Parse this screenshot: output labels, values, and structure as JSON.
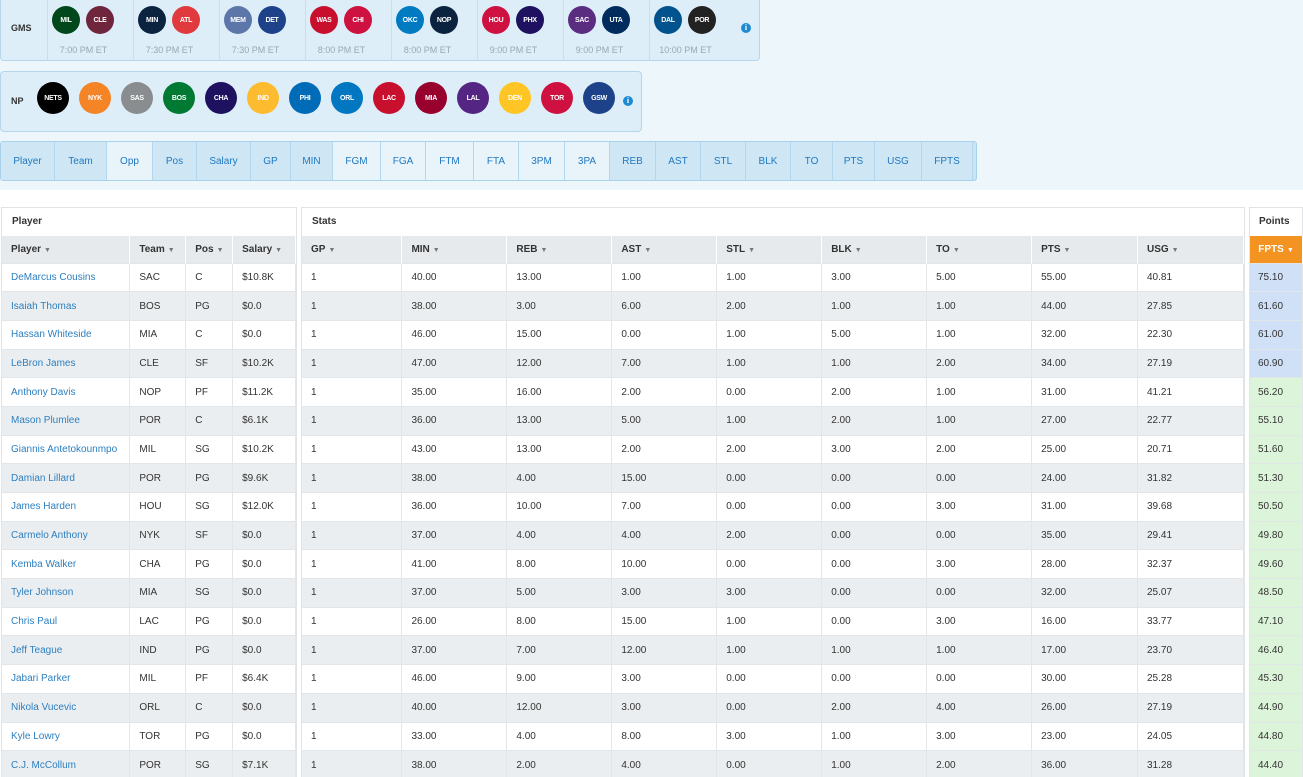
{
  "games": {
    "label": "GMS",
    "list": [
      {
        "away": "MIL",
        "home": "CLE",
        "time": "7:00 PM ET",
        "away_color": "#00471b",
        "home_color": "#6f263d"
      },
      {
        "away": "MIN",
        "home": "ATL",
        "time": "7:30 PM ET",
        "away_color": "#0c2340",
        "home_color": "#e03a3e"
      },
      {
        "away": "MEM",
        "home": "DET",
        "time": "7:30 PM ET",
        "away_color": "#5d76a9",
        "home_color": "#1d428a"
      },
      {
        "away": "WAS",
        "home": "CHI",
        "time": "8:00 PM ET",
        "away_color": "#c8102e",
        "home_color": "#ce1141"
      },
      {
        "away": "OKC",
        "home": "NOP",
        "time": "8:00 PM ET",
        "away_color": "#007ac1",
        "home_color": "#0c2340"
      },
      {
        "away": "HOU",
        "home": "PHX",
        "time": "9:00 PM ET",
        "away_color": "#ce1141",
        "home_color": "#1d1160"
      },
      {
        "away": "SAC",
        "home": "UTA",
        "time": "9:00 PM ET",
        "away_color": "#5a2d81",
        "home_color": "#002b5c"
      },
      {
        "away": "DAL",
        "home": "POR",
        "time": "10:00 PM ET",
        "away_color": "#00538c",
        "home_color": "#222222"
      }
    ]
  },
  "np": {
    "label": "NP",
    "teams": [
      {
        "abbr": "NETS",
        "color": "#000000"
      },
      {
        "abbr": "NYK",
        "color": "#f58426"
      },
      {
        "abbr": "SAS",
        "color": "#8a8d8f"
      },
      {
        "abbr": "BOS",
        "color": "#007a33"
      },
      {
        "abbr": "CHA",
        "color": "#1d1160"
      },
      {
        "abbr": "IND",
        "color": "#fdbb30"
      },
      {
        "abbr": "PHI",
        "color": "#006bb6"
      },
      {
        "abbr": "ORL",
        "color": "#0077c0"
      },
      {
        "abbr": "LAC",
        "color": "#c8102e"
      },
      {
        "abbr": "MIA",
        "color": "#98002e"
      },
      {
        "abbr": "LAL",
        "color": "#552583"
      },
      {
        "abbr": "DEN",
        "color": "#fec524"
      },
      {
        "abbr": "TOR",
        "color": "#ce1141"
      },
      {
        "abbr": "GSW",
        "color": "#1d428a"
      }
    ]
  },
  "column_toggles": [
    {
      "label": "Player",
      "on": false,
      "w": 54
    },
    {
      "label": "Team",
      "on": false,
      "w": 52
    },
    {
      "label": "Opp",
      "on": true,
      "w": 46
    },
    {
      "label": "Pos",
      "on": false,
      "w": 44
    },
    {
      "label": "Salary",
      "on": false,
      "w": 54
    },
    {
      "label": "GP",
      "on": false,
      "w": 40
    },
    {
      "label": "MIN",
      "on": false,
      "w": 42
    },
    {
      "label": "FGM",
      "on": true,
      "w": 48
    },
    {
      "label": "FGA",
      "on": true,
      "w": 45
    },
    {
      "label": "FTM",
      "on": true,
      "w": 48
    },
    {
      "label": "FTA",
      "on": true,
      "w": 45
    },
    {
      "label": "3PM",
      "on": true,
      "w": 46
    },
    {
      "label": "3PA",
      "on": true,
      "w": 45
    },
    {
      "label": "REB",
      "on": false,
      "w": 46
    },
    {
      "label": "AST",
      "on": false,
      "w": 45
    },
    {
      "label": "STL",
      "on": false,
      "w": 45
    },
    {
      "label": "BLK",
      "on": false,
      "w": 45
    },
    {
      "label": "TO",
      "on": false,
      "w": 42
    },
    {
      "label": "PTS",
      "on": false,
      "w": 42
    },
    {
      "label": "USG",
      "on": false,
      "w": 47
    },
    {
      "label": "FPTS",
      "on": false,
      "w": 51
    }
  ],
  "player_panel": {
    "title": "Player",
    "headers": [
      "Player",
      "Team",
      "Pos",
      "Salary"
    ]
  },
  "stats_panel": {
    "title": "Stats",
    "headers": [
      "GP",
      "MIN",
      "REB",
      "AST",
      "STL",
      "BLK",
      "TO",
      "PTS",
      "USG"
    ]
  },
  "points_panel": {
    "title": "Points",
    "header": "FPTS"
  },
  "rows": [
    {
      "player": "DeMarcus Cousins",
      "team": "SAC",
      "pos": "C",
      "salary": "$10.8K",
      "gp": "1",
      "min": "40.00",
      "reb": "13.00",
      "ast": "1.00",
      "stl": "1.00",
      "blk": "3.00",
      "to": "5.00",
      "pts": "55.00",
      "usg": "40.81",
      "fpts": "75.10",
      "tier": "blue"
    },
    {
      "player": "Isaiah Thomas",
      "team": "BOS",
      "pos": "PG",
      "salary": "$0.0",
      "gp": "1",
      "min": "38.00",
      "reb": "3.00",
      "ast": "6.00",
      "stl": "2.00",
      "blk": "1.00",
      "to": "1.00",
      "pts": "44.00",
      "usg": "27.85",
      "fpts": "61.60",
      "tier": "blue"
    },
    {
      "player": "Hassan Whiteside",
      "team": "MIA",
      "pos": "C",
      "salary": "$0.0",
      "gp": "1",
      "min": "46.00",
      "reb": "15.00",
      "ast": "0.00",
      "stl": "1.00",
      "blk": "5.00",
      "to": "1.00",
      "pts": "32.00",
      "usg": "22.30",
      "fpts": "61.00",
      "tier": "blue"
    },
    {
      "player": "LeBron James",
      "team": "CLE",
      "pos": "SF",
      "salary": "$10.2K",
      "gp": "1",
      "min": "47.00",
      "reb": "12.00",
      "ast": "7.00",
      "stl": "1.00",
      "blk": "1.00",
      "to": "2.00",
      "pts": "34.00",
      "usg": "27.19",
      "fpts": "60.90",
      "tier": "blue"
    },
    {
      "player": "Anthony Davis",
      "team": "NOP",
      "pos": "PF",
      "salary": "$11.2K",
      "gp": "1",
      "min": "35.00",
      "reb": "16.00",
      "ast": "2.00",
      "stl": "0.00",
      "blk": "2.00",
      "to": "1.00",
      "pts": "31.00",
      "usg": "41.21",
      "fpts": "56.20",
      "tier": "green"
    },
    {
      "player": "Mason Plumlee",
      "team": "POR",
      "pos": "C",
      "salary": "$6.1K",
      "gp": "1",
      "min": "36.00",
      "reb": "13.00",
      "ast": "5.00",
      "stl": "1.00",
      "blk": "2.00",
      "to": "1.00",
      "pts": "27.00",
      "usg": "22.77",
      "fpts": "55.10",
      "tier": "green"
    },
    {
      "player": "Giannis Antetokounmpo",
      "team": "MIL",
      "pos": "SG",
      "salary": "$10.2K",
      "gp": "1",
      "min": "43.00",
      "reb": "13.00",
      "ast": "2.00",
      "stl": "2.00",
      "blk": "3.00",
      "to": "2.00",
      "pts": "25.00",
      "usg": "20.71",
      "fpts": "51.60",
      "tier": "green"
    },
    {
      "player": "Damian Lillard",
      "team": "POR",
      "pos": "PG",
      "salary": "$9.6K",
      "gp": "1",
      "min": "38.00",
      "reb": "4.00",
      "ast": "15.00",
      "stl": "0.00",
      "blk": "0.00",
      "to": "0.00",
      "pts": "24.00",
      "usg": "31.82",
      "fpts": "51.30",
      "tier": "green"
    },
    {
      "player": "James Harden",
      "team": "HOU",
      "pos": "SG",
      "salary": "$12.0K",
      "gp": "1",
      "min": "36.00",
      "reb": "10.00",
      "ast": "7.00",
      "stl": "0.00",
      "blk": "0.00",
      "to": "3.00",
      "pts": "31.00",
      "usg": "39.68",
      "fpts": "50.50",
      "tier": "green"
    },
    {
      "player": "Carmelo Anthony",
      "team": "NYK",
      "pos": "SF",
      "salary": "$0.0",
      "gp": "1",
      "min": "37.00",
      "reb": "4.00",
      "ast": "4.00",
      "stl": "2.00",
      "blk": "0.00",
      "to": "0.00",
      "pts": "35.00",
      "usg": "29.41",
      "fpts": "49.80",
      "tier": "green"
    },
    {
      "player": "Kemba Walker",
      "team": "CHA",
      "pos": "PG",
      "salary": "$0.0",
      "gp": "1",
      "min": "41.00",
      "reb": "8.00",
      "ast": "10.00",
      "stl": "0.00",
      "blk": "0.00",
      "to": "3.00",
      "pts": "28.00",
      "usg": "32.37",
      "fpts": "49.60",
      "tier": "green"
    },
    {
      "player": "Tyler Johnson",
      "team": "MIA",
      "pos": "SG",
      "salary": "$0.0",
      "gp": "1",
      "min": "37.00",
      "reb": "5.00",
      "ast": "3.00",
      "stl": "3.00",
      "blk": "0.00",
      "to": "0.00",
      "pts": "32.00",
      "usg": "25.07",
      "fpts": "48.50",
      "tier": "green"
    },
    {
      "player": "Chris Paul",
      "team": "LAC",
      "pos": "PG",
      "salary": "$0.0",
      "gp": "1",
      "min": "26.00",
      "reb": "8.00",
      "ast": "15.00",
      "stl": "1.00",
      "blk": "0.00",
      "to": "3.00",
      "pts": "16.00",
      "usg": "33.77",
      "fpts": "47.10",
      "tier": "green"
    },
    {
      "player": "Jeff Teague",
      "team": "IND",
      "pos": "PG",
      "salary": "$0.0",
      "gp": "1",
      "min": "37.00",
      "reb": "7.00",
      "ast": "12.00",
      "stl": "1.00",
      "blk": "1.00",
      "to": "1.00",
      "pts": "17.00",
      "usg": "23.70",
      "fpts": "46.40",
      "tier": "green"
    },
    {
      "player": "Jabari Parker",
      "team": "MIL",
      "pos": "PF",
      "salary": "$6.4K",
      "gp": "1",
      "min": "46.00",
      "reb": "9.00",
      "ast": "3.00",
      "stl": "0.00",
      "blk": "0.00",
      "to": "0.00",
      "pts": "30.00",
      "usg": "25.28",
      "fpts": "45.30",
      "tier": "green"
    },
    {
      "player": "Nikola Vucevic",
      "team": "ORL",
      "pos": "C",
      "salary": "$0.0",
      "gp": "1",
      "min": "40.00",
      "reb": "12.00",
      "ast": "3.00",
      "stl": "0.00",
      "blk": "2.00",
      "to": "4.00",
      "pts": "26.00",
      "usg": "27.19",
      "fpts": "44.90",
      "tier": "green"
    },
    {
      "player": "Kyle Lowry",
      "team": "TOR",
      "pos": "PG",
      "salary": "$0.0",
      "gp": "1",
      "min": "33.00",
      "reb": "4.00",
      "ast": "8.00",
      "stl": "3.00",
      "blk": "1.00",
      "to": "3.00",
      "pts": "23.00",
      "usg": "24.05",
      "fpts": "44.80",
      "tier": "green"
    },
    {
      "player": "C.J. McCollum",
      "team": "POR",
      "pos": "SG",
      "salary": "$7.1K",
      "gp": "1",
      "min": "38.00",
      "reb": "2.00",
      "ast": "4.00",
      "stl": "0.00",
      "blk": "1.00",
      "to": "2.00",
      "pts": "36.00",
      "usg": "31.28",
      "fpts": "44.40",
      "tier": "green"
    }
  ]
}
